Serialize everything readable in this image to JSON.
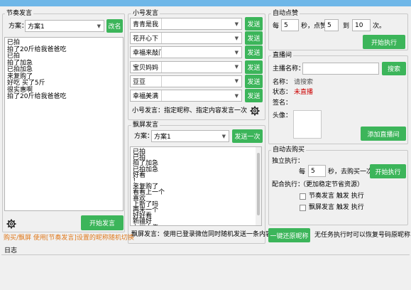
{
  "topbar": {
    "color": "#6fb7e8"
  },
  "colors": {
    "accent": "#3cb55a",
    "status_red": "#cc0000"
  },
  "rhythm": {
    "title": "节奏发言",
    "plan_label": "方案：",
    "plan_value": "方案1",
    "rename": "改名",
    "lines": [
      "已拍",
      "拍了20斤给我爸爸吃",
      "已拍",
      "拍了加急",
      "已拍加急",
      "来复购了",
      "好吃 买了5斤",
      "很实惠啊",
      "拍了20斤给我爸爸吃"
    ],
    "start": "开始发言"
  },
  "note": "购买/飘屏 使用[节奏发言]设置的昵称随机切换",
  "alt": {
    "title": "小号发言",
    "accounts": [
      "青青是我",
      "花开心下",
      "幸福来敲门",
      "宝贝妈妈",
      "豆豆",
      "幸福美满"
    ],
    "send": "发送",
    "hint": "小号发言：指定昵称、指定内容发言一次"
  },
  "float": {
    "title": "飘屏发言",
    "plan_label": "方案：",
    "plan_value": "方案1",
    "send_once": "发送一次",
    "lines": [
      "已拍",
      "已拍",
      "拍了加急",
      "已拍加急",
      "好看",
      "！",
      "来复购了",
      "看看上一个",
      "喜欢",
      "上新了吗",
      "再来一个",
      "好好看",
      "新疆好",
      "九洲大佬"
    ],
    "hint": "飘屏发言：使用已登录微信同时随机发送一条内容"
  },
  "auto_like": {
    "title": "自动点赞",
    "every": "每",
    "every_val": "5",
    "sec_like": "秒，点赞",
    "from": "5",
    "to_label": "到",
    "to": "10",
    "times": "次。",
    "start": "开始执行"
  },
  "live": {
    "title": "直播间",
    "host_label": "主播名称：",
    "host_value": "",
    "search": "搜索",
    "name_label": "名称：",
    "name_value": "请搜索",
    "status_label": "状态：",
    "status_value": "未直播",
    "sign_label": "签名：",
    "sign_value": "",
    "avatar_label": "头像：",
    "add": "添加直播间"
  },
  "auto_buy": {
    "title": "自动去购买",
    "solo_label": "独立执行：",
    "every": "每",
    "every_val": "5",
    "sec_buy": "秒，去购买一次",
    "start": "开始执行",
    "combo_label": "配合执行：",
    "combo_note": "（更加稳定节省资源）",
    "opt1": "节奏发言 触发 执行",
    "opt2": "飘屏发言 触发 执行"
  },
  "restore": {
    "button": "一键还原昵称",
    "note": "无任务执行时可以恢复号码原昵称"
  },
  "log": {
    "title": "日志"
  }
}
